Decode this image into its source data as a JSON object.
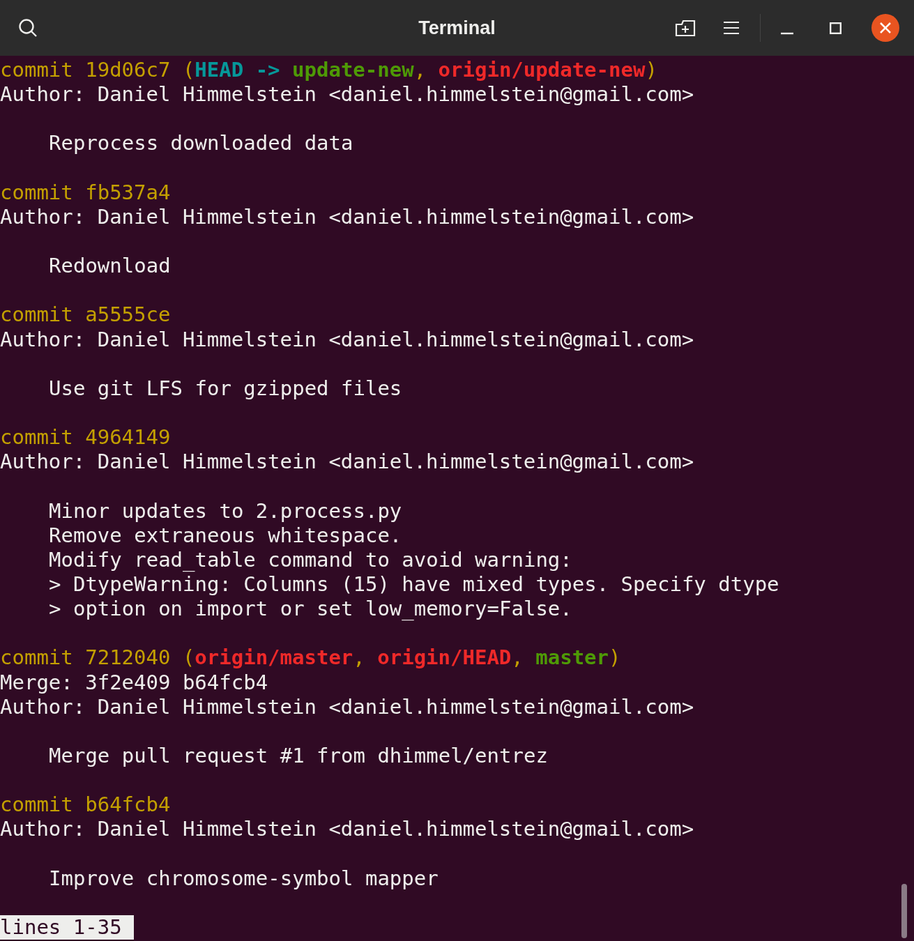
{
  "window": {
    "title": "Terminal"
  },
  "commits": [
    {
      "header": [
        {
          "text": "commit 19d06c7 (",
          "kind": "hash"
        },
        {
          "text": "HEAD -> ",
          "kind": "head"
        },
        {
          "text": "update-new",
          "kind": "local"
        },
        {
          "text": ", ",
          "kind": "hash"
        },
        {
          "text": "origin/update-new",
          "kind": "remote"
        },
        {
          "text": ")",
          "kind": "hash"
        }
      ],
      "author": "Author: Daniel Himmelstein <daniel.himmelstein@gmail.com>",
      "message": [
        "Reprocess downloaded data"
      ]
    },
    {
      "header": [
        {
          "text": "commit fb537a4",
          "kind": "hash"
        }
      ],
      "author": "Author: Daniel Himmelstein <daniel.himmelstein@gmail.com>",
      "message": [
        "Redownload"
      ]
    },
    {
      "header": [
        {
          "text": "commit a5555ce",
          "kind": "hash"
        }
      ],
      "author": "Author: Daniel Himmelstein <daniel.himmelstein@gmail.com>",
      "message": [
        "Use git LFS for gzipped files"
      ]
    },
    {
      "header": [
        {
          "text": "commit 4964149",
          "kind": "hash"
        }
      ],
      "author": "Author: Daniel Himmelstein <daniel.himmelstein@gmail.com>",
      "message": [
        "Minor updates to 2.process.py",
        "Remove extraneous whitespace.",
        "Modify read_table command to avoid warning:",
        "> DtypeWarning: Columns (15) have mixed types. Specify dtype",
        "> option on import or set low_memory=False."
      ]
    },
    {
      "header": [
        {
          "text": "commit 7212040 (",
          "kind": "hash"
        },
        {
          "text": "origin/master",
          "kind": "remote"
        },
        {
          "text": ", ",
          "kind": "hash"
        },
        {
          "text": "origin/HEAD",
          "kind": "remote"
        },
        {
          "text": ", ",
          "kind": "hash"
        },
        {
          "text": "master",
          "kind": "local"
        },
        {
          "text": ")",
          "kind": "hash"
        }
      ],
      "merge": "Merge: 3f2e409 b64fcb4",
      "author": "Author: Daniel Himmelstein <daniel.himmelstein@gmail.com>",
      "message": [
        "Merge pull request #1 from dhimmel/entrez"
      ]
    },
    {
      "header": [
        {
          "text": "commit b64fcb4",
          "kind": "hash"
        }
      ],
      "author": "Author: Daniel Himmelstein <daniel.himmelstein@gmail.com>",
      "message": [
        "Improve chromosome-symbol mapper"
      ]
    }
  ],
  "status_line": "lines 1-35"
}
